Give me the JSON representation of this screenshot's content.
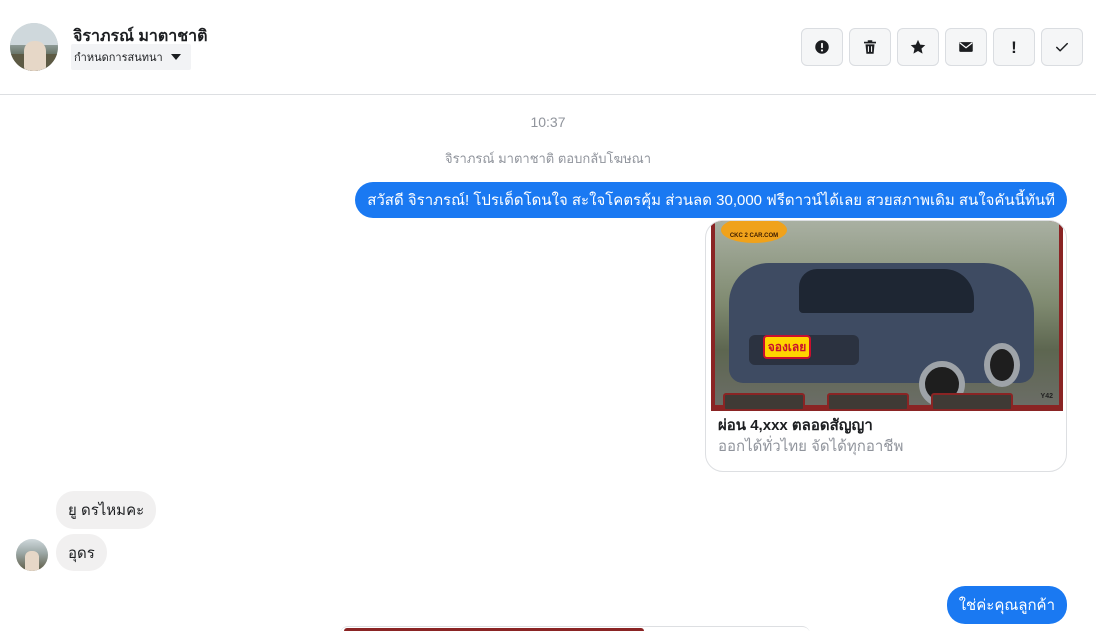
{
  "header": {
    "contact_name": "จิราภรณ์ มาตาชาติ",
    "assign_label": "กำหนดการสนทนา",
    "tools": [
      {
        "name": "report-spam-button",
        "icon": "alert-circle-icon"
      },
      {
        "name": "delete-button",
        "icon": "trash-icon"
      },
      {
        "name": "star-button",
        "icon": "star-icon"
      },
      {
        "name": "mark-unread-button",
        "icon": "envelope-icon"
      },
      {
        "name": "follow-up-button",
        "icon": "exclamation-icon",
        "glyph": "!"
      },
      {
        "name": "mark-done-button",
        "icon": "checkmark-icon"
      }
    ]
  },
  "thread": {
    "timestamp": "10:37",
    "ad_reply_note": "จิราภรณ์ มาตาชาติ ตอบกลับโฆษณา",
    "messages": [
      {
        "direction": "outgoing",
        "text": "สวัสดี จิราภรณ์! โปรเด็ดโดนใจ สะใจโคตรคุ้ม ส่วนลด 30,000 ฟรีดาวน์ได้เลย สวยสภาพเดิม สนใจคันนี้ทันที"
      },
      {
        "direction": "incoming",
        "text": "ยู ดรไหมคะ"
      },
      {
        "direction": "incoming",
        "text": "อุดร"
      },
      {
        "direction": "outgoing",
        "text": "ใช่ค่ะคุณลูกค้า"
      }
    ],
    "ad_card": {
      "title": "ผ่อน 4,xxx ตลอดสัญญา",
      "subtitle": "ออกได้ทั่วไทย จัดได้ทุกอาชีพ",
      "image_logo_text": "CKC 2 CAR.COM",
      "image_sticker_text": "จองเลย",
      "image_year_text": "Y42"
    }
  },
  "colors": {
    "outgoing_bubble": "#1a79f2",
    "incoming_bubble": "#f1f0f0",
    "muted_text": "#90949c"
  }
}
